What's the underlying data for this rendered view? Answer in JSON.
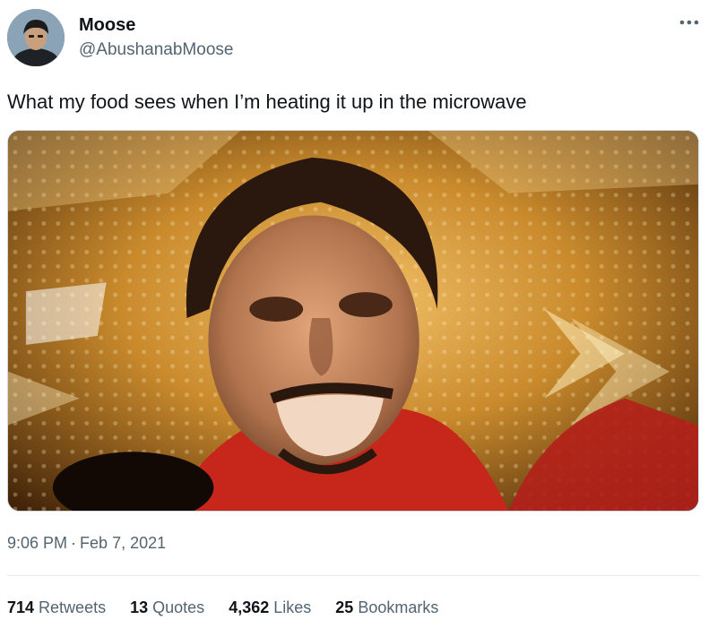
{
  "user": {
    "display_name": "Moose",
    "handle": "@AbushanabMoose"
  },
  "tweet": {
    "text": "What my food sees when I’m heating it up in the microwave",
    "time": "9:06 PM",
    "separator": "·",
    "date": "Feb 7, 2021"
  },
  "stats": {
    "retweets_count": "714",
    "retweets_label": "Retweets",
    "quotes_count": "13",
    "quotes_label": "Quotes",
    "likes_count": "4,362",
    "likes_label": "Likes",
    "bookmarks_count": "25",
    "bookmarks_label": "Bookmarks"
  },
  "icons": {
    "more": "more-options-icon"
  },
  "colors": {
    "text_primary": "#0f1419",
    "text_secondary": "#536471",
    "divider": "#e6ebee"
  }
}
